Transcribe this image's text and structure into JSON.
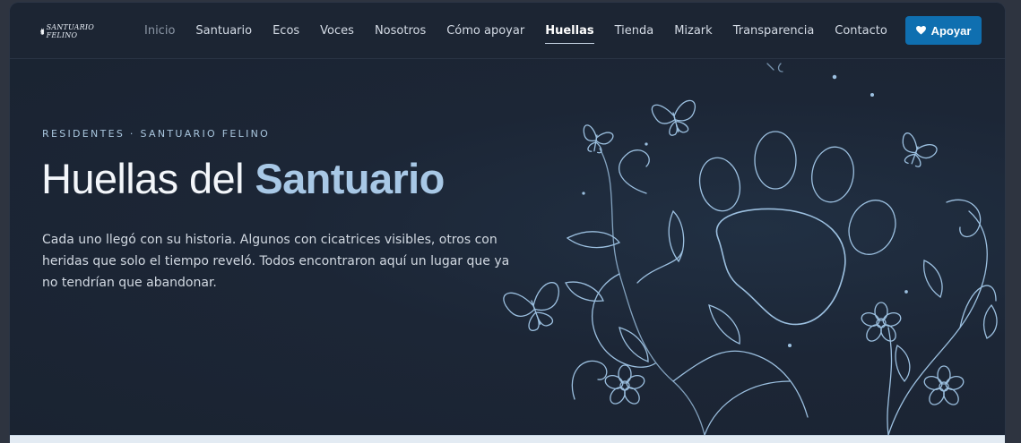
{
  "brand": {
    "logo_line1": "SANTUARIO",
    "logo_line2": "FELINO"
  },
  "nav": {
    "items": [
      {
        "label": "Inicio",
        "state": "muted"
      },
      {
        "label": "Santuario",
        "state": "normal"
      },
      {
        "label": "Ecos",
        "state": "normal"
      },
      {
        "label": "Voces",
        "state": "normal"
      },
      {
        "label": "Nosotros",
        "state": "normal"
      },
      {
        "label": "Cómo apoyar",
        "state": "normal"
      },
      {
        "label": "Huellas",
        "state": "active"
      },
      {
        "label": "Tienda",
        "state": "normal"
      },
      {
        "label": "Mizark",
        "state": "normal"
      },
      {
        "label": "Transparencia",
        "state": "normal"
      },
      {
        "label": "Contacto",
        "state": "normal"
      }
    ]
  },
  "support_button": {
    "label": "Apoyar",
    "icon": "heart-icon",
    "color": "#0f6fb0"
  },
  "hero": {
    "eyebrow": "RESIDENTES · SANTUARIO FELINO",
    "title_plain": "Huellas del ",
    "title_accent": "Santuario",
    "description": "Cada uno llegó con su historia. Algunos con cicatrices visibles, otros con heridas que solo el tiempo reveló. Todos encontraron aquí un lugar que ya no tendrían que abandonar.",
    "accent_color": "#a8c8e6"
  },
  "colors": {
    "background": "#1b2432",
    "line_art": "#9cc0e0"
  }
}
